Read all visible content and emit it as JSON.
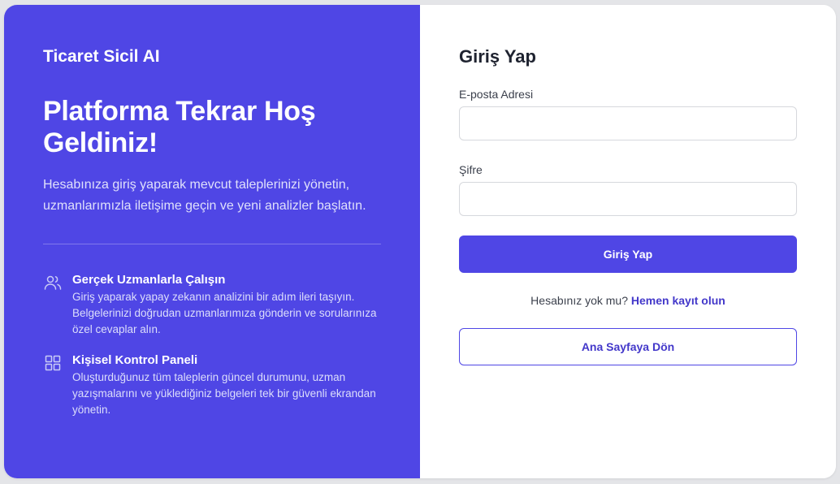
{
  "colors": {
    "accent": "#4f46e5",
    "panel_text": "#ffffff",
    "link": "#4338ca",
    "page_background": "#e4e5e8"
  },
  "left_panel": {
    "brand": "Ticaret Sicil AI",
    "headline": "Platforma Tekrar Hoş Geldiniz!",
    "lead": "Hesabınıza giriş yaparak mevcut taleplerinizi yönetin, uzmanlarımızla iletişime geçin ve yeni analizler başlatın.",
    "features": [
      {
        "icon": "users-icon",
        "title": "Gerçek Uzmanlarla Çalışın",
        "description": "Giriş yaparak yapay zekanın analizini bir adım ileri taşıyın. Belgelerinizi doğrudan uzmanlarımıza gönderin ve sorularınıza özel cevaplar alın."
      },
      {
        "icon": "grid-icon",
        "title": "Kişisel Kontrol Paneli",
        "description": "Oluşturduğunuz tüm taleplerin güncel durumunu, uzman yazışmalarını ve yüklediğiniz belgeleri tek bir güvenli ekrandan yönetin."
      }
    ]
  },
  "login_form": {
    "title": "Giriş Yap",
    "email_label": "E-posta Adresi",
    "email_value": "",
    "password_label": "Şifre",
    "password_value": "",
    "submit_label": "Giriş Yap",
    "signup_prompt": "Hesabınız yok mu?",
    "signup_link": "Hemen kayıt olun",
    "home_button": "Ana Sayfaya Dön"
  }
}
